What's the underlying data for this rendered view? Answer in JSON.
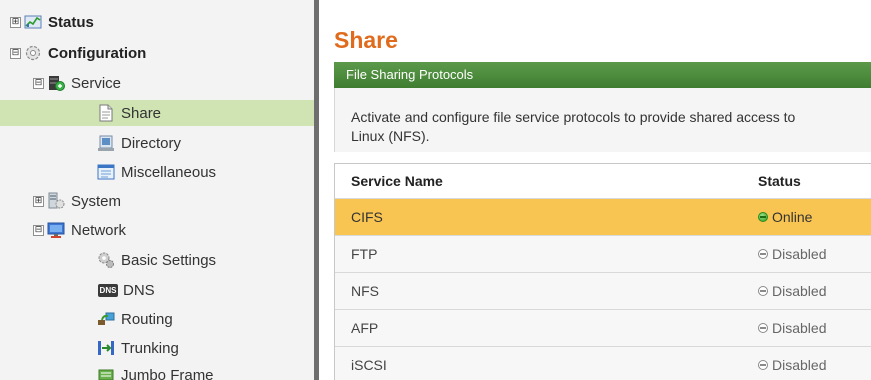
{
  "tree": {
    "status": {
      "label": "Status",
      "icon": "chart-icon"
    },
    "configuration": {
      "label": "Configuration",
      "icon": "gear-icon"
    },
    "service": {
      "label": "Service",
      "icon": "service-icon"
    },
    "share": {
      "label": "Share",
      "icon": "document-icon"
    },
    "directory": {
      "label": "Directory",
      "icon": "directory-icon"
    },
    "miscellaneous": {
      "label": "Miscellaneous",
      "icon": "window-icon"
    },
    "system": {
      "label": "System",
      "icon": "system-icon"
    },
    "network": {
      "label": "Network",
      "icon": "monitor-icon"
    },
    "basic_settings": {
      "label": "Basic Settings",
      "icon": "gears-icon"
    },
    "dns": {
      "label": "DNS",
      "icon_text": "DNS"
    },
    "routing": {
      "label": "Routing",
      "icon": "routing-icon"
    },
    "trunking": {
      "label": "Trunking",
      "icon": "trunking-icon"
    },
    "jumbo_frame": {
      "label": "Jumbo Frame",
      "icon": "jumbo-frame-icon"
    },
    "toggle_plus": "⊞",
    "toggle_minus": "⊟"
  },
  "main": {
    "title": "Share",
    "section_header": "File Sharing Protocols",
    "description_line1": "Activate and configure file service protocols to provide shared access to",
    "description_line2": "Linux (NFS).",
    "table": {
      "headers": {
        "service_name": "Service Name",
        "status": "Status"
      },
      "rows": [
        {
          "name": "CIFS",
          "status": "Online",
          "state": "online"
        },
        {
          "name": "FTP",
          "status": "Disabled",
          "state": "disabled"
        },
        {
          "name": "NFS",
          "status": "Disabled",
          "state": "disabled"
        },
        {
          "name": "AFP",
          "status": "Disabled",
          "state": "disabled"
        },
        {
          "name": "iSCSI",
          "status": "Disabled",
          "state": "disabled"
        }
      ]
    }
  },
  "colors": {
    "title_orange": "#e06b1c",
    "header_green": "#4a8a3a",
    "highlight_row": "#f9c552",
    "selected_tree": "#cfe3b3"
  }
}
